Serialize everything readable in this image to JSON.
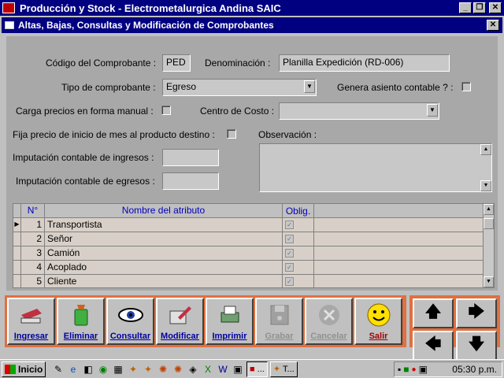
{
  "app": {
    "title": "Producción y Stock - Electrometalurgica Andina SAIC"
  },
  "window": {
    "title": "Altas, Bajas, Consultas y Modificación de Comprobantes"
  },
  "form": {
    "codigo_label": "Código del Comprobante :",
    "codigo_value": "PED",
    "denominacion_label": "Denominación :",
    "denominacion_value": "Planilla Expedición (RD-006)",
    "tipo_label": "Tipo de comprobante :",
    "tipo_value": "Egreso",
    "genera_label": "Genera asiento contable ? :",
    "carga_label": "Carga precios en forma manual :",
    "centro_label": "Centro de Costo :",
    "centro_value": "",
    "fija_label": "Fija precio de inicio de mes al producto destino :",
    "observacion_label": "Observación :",
    "imp_ingresos_label": "Imputación contable de ingresos :",
    "imp_egresos_label": "Imputación contable de egresos :"
  },
  "grid": {
    "headers": [
      "N°",
      "Nombre del atributo",
      "Oblig."
    ],
    "rows": [
      {
        "n": "1",
        "name": "Transportista"
      },
      {
        "n": "2",
        "name": "Señor"
      },
      {
        "n": "3",
        "name": "Camión"
      },
      {
        "n": "4",
        "name": "Acoplado"
      },
      {
        "n": "5",
        "name": "Cliente"
      }
    ]
  },
  "toolbar": {
    "ingresar": "Ingresar",
    "eliminar": "Eliminar",
    "consultar": "Consultar",
    "modificar": "Modificar",
    "imprimir": "Imprimir",
    "grabar": "Grabar",
    "cancelar": "Cancelar",
    "salir": "Salir"
  },
  "taskbar": {
    "start": "Inicio",
    "task1": "...",
    "task2": "T...",
    "clock": "05:30 p.m."
  },
  "icons": {
    "ingresar": "printer-add-icon",
    "eliminar": "trash-icon",
    "consultar": "eye-icon",
    "modificar": "edit-icon",
    "imprimir": "printer-icon",
    "grabar": "disk-icon",
    "cancelar": "cancel-icon",
    "salir": "smiley-icon"
  },
  "colors": {
    "titlebar": "#000080",
    "toolbar_border": "#e07040",
    "form_bg": "#a8a8a8"
  }
}
